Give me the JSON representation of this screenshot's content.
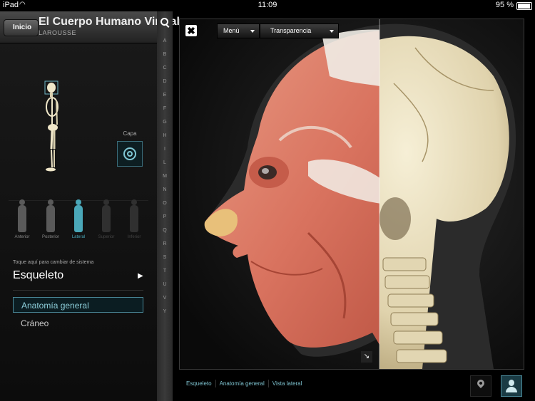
{
  "status_bar": {
    "carrier": "iPad",
    "time": "11:09",
    "battery": "95 %"
  },
  "header": {
    "back_label": "Inicio",
    "title": "El Cuerpo Humano Virtual",
    "subtitle": "LAROUSSE"
  },
  "layer": {
    "label": "Capa"
  },
  "views": [
    {
      "label": "Anterior",
      "state": "normal"
    },
    {
      "label": "Posterior",
      "state": "normal"
    },
    {
      "label": "Lateral",
      "state": "active"
    },
    {
      "label": "Superior",
      "state": "disabled"
    },
    {
      "label": "Inferior",
      "state": "disabled"
    }
  ],
  "system": {
    "hint": "Toque aquí para cambiar de sistema",
    "name": "Esqueleto"
  },
  "topics": [
    {
      "label": "Anatomía general",
      "selected": true
    },
    {
      "label": "Cráneo",
      "selected": false
    }
  ],
  "alphabet_index": [
    "A",
    "B",
    "C",
    "D",
    "E",
    "F",
    "G",
    "H",
    "I",
    "L",
    "M",
    "N",
    "O",
    "P",
    "Q",
    "R",
    "S",
    "T",
    "U",
    "V",
    "Y"
  ],
  "viewer": {
    "menu_label": "Menú",
    "transparency_label": "Transparencia"
  },
  "breadcrumbs": [
    "Esqueleto",
    "Anatomía general",
    "Vista lateral"
  ],
  "colors": {
    "accent": "#4aa7b8",
    "muscle": "#d9735f",
    "bone": "#e6dcbc"
  }
}
